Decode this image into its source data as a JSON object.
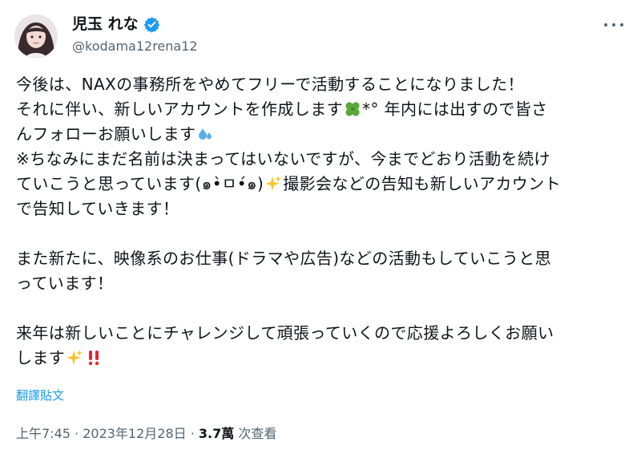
{
  "header": {
    "display_name": "児玉 れな",
    "handle": "@kodama12rena12",
    "avatar_icon": "profile-photo",
    "verified_icon": "verified-badge-icon",
    "more_icon": "more-options-icon",
    "verified_color": "#1d9bf0"
  },
  "tweet": {
    "line1": "今後は、NAXの事務所をやめてフリーで活動することになりました！",
    "line2a": "それに伴い、新しいアカウントを作成します",
    "line2b": "*° 年内には出すので皆さ",
    "line3": "んフォローお願いします",
    "line4": "※ちなみにまだ名前は決まってはいないですが、今までどおり活動を続け",
    "line5a": "ていこうと思っています(๑•̀ㅁ•́๑)",
    "line5b": "撮影会などの告知も新しいアカウント",
    "line6": "で告知していきます！",
    "line7": "また新たに、映像系のお仕事(ドラマや広告)などの活動もしていこうと思",
    "line8": "っています！",
    "line9": "来年は新しいことにチャレンジして頑張っていくので応援よろしくお願い",
    "line10": "します"
  },
  "emojis": {
    "clover": "four-leaf-clover-icon",
    "sweat": "sweat-droplets-icon",
    "sparkles": "sparkles-icon",
    "exclaim": "double-exclamation-icon"
  },
  "translate_label": "翻譯貼文",
  "meta": {
    "time": "上午7:45",
    "sep1": " · ",
    "date": "2023年12月28日",
    "sep2": " · ",
    "views": "3.7萬",
    "views_label": " 次查看"
  }
}
